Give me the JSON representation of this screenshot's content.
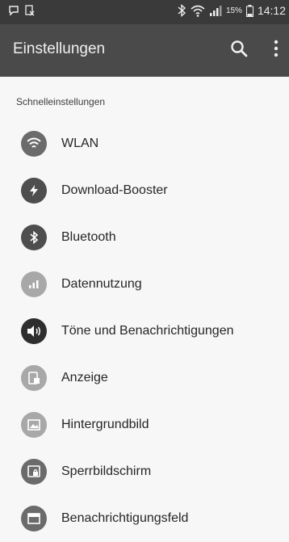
{
  "status_bar": {
    "battery_percent": "15%",
    "time": "14:12"
  },
  "app_bar": {
    "title": "Einstellungen"
  },
  "section": {
    "header": "Schnelleinstellungen"
  },
  "items": [
    {
      "label": "WLAN",
      "icon": "wifi-icon"
    },
    {
      "label": "Download-Booster",
      "icon": "lightning-icon"
    },
    {
      "label": "Bluetooth",
      "icon": "bluetooth-icon"
    },
    {
      "label": "Datennutzung",
      "icon": "data-usage-icon"
    },
    {
      "label": "Töne und Benachrichtigungen",
      "icon": "speaker-icon"
    },
    {
      "label": "Anzeige",
      "icon": "display-icon"
    },
    {
      "label": "Hintergrundbild",
      "icon": "wallpaper-icon"
    },
    {
      "label": "Sperrbildschirm",
      "icon": "lock-screen-icon"
    },
    {
      "label": "Benachrichtigungsfeld",
      "icon": "notification-panel-icon"
    }
  ]
}
